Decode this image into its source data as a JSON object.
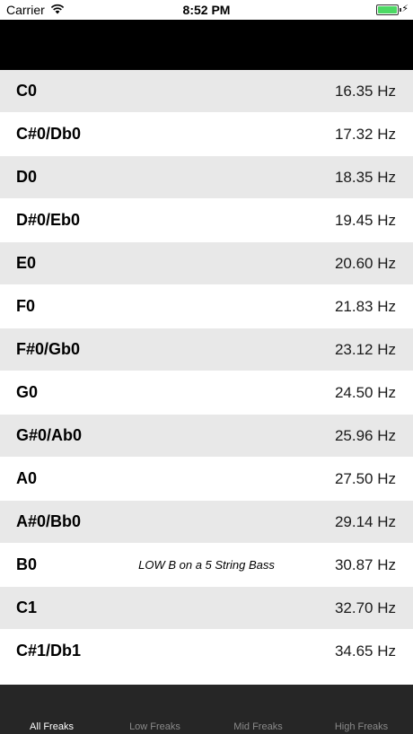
{
  "status_bar": {
    "carrier": "Carrier",
    "time": "8:52 PM",
    "battery_color": "#4cd964"
  },
  "notes": [
    {
      "name": "C0",
      "comment": "",
      "frequency": "16.35 Hz"
    },
    {
      "name": "C#0/Db0",
      "comment": "",
      "frequency": "17.32 Hz"
    },
    {
      "name": "D0",
      "comment": "",
      "frequency": "18.35 Hz"
    },
    {
      "name": "D#0/Eb0",
      "comment": "",
      "frequency": "19.45 Hz"
    },
    {
      "name": "E0",
      "comment": "",
      "frequency": "20.60 Hz"
    },
    {
      "name": "F0",
      "comment": "",
      "frequency": "21.83 Hz"
    },
    {
      "name": "F#0/Gb0",
      "comment": "",
      "frequency": "23.12 Hz"
    },
    {
      "name": "G0",
      "comment": "",
      "frequency": "24.50 Hz"
    },
    {
      "name": "G#0/Ab0",
      "comment": "",
      "frequency": "25.96 Hz"
    },
    {
      "name": "A0",
      "comment": "",
      "frequency": "27.50 Hz"
    },
    {
      "name": "A#0/Bb0",
      "comment": "",
      "frequency": "29.14 Hz"
    },
    {
      "name": "B0",
      "comment": "LOW B on a 5 String Bass",
      "frequency": "30.87 Hz"
    },
    {
      "name": "C1",
      "comment": "",
      "frequency": "32.70 Hz"
    },
    {
      "name": "C#1/Db1",
      "comment": "",
      "frequency": "34.65 Hz"
    }
  ],
  "tabs": [
    {
      "label": "All  Freaks",
      "active": true
    },
    {
      "label": "Low Freaks",
      "active": false
    },
    {
      "label": "Mid Freaks",
      "active": false
    },
    {
      "label": "High Freaks",
      "active": false
    }
  ]
}
